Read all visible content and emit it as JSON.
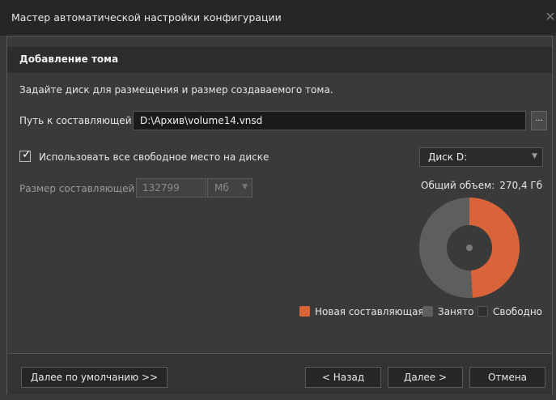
{
  "window": {
    "title": "Мастер автоматической настройки конфигурации",
    "close_glyph": "✕"
  },
  "section": {
    "header": "Добавление тома",
    "description": "Задайте диск для размещения и размер создаваемого тома."
  },
  "path": {
    "label": "Путь к составляющей:",
    "value": "D:\\Архив\\volume14.vnsd",
    "browse_label": "..."
  },
  "use_all_space": {
    "label": "Использовать все свободное место на диске",
    "checked": true,
    "check_glyph": "✓"
  },
  "size": {
    "label": "Размер составляющей",
    "value": "132799",
    "unit": "Мб",
    "disabled": true
  },
  "disk": {
    "selected": "Диск D:",
    "total_label": "Общий объем:",
    "total_value": "270,4 Гб"
  },
  "usage_chart": {
    "new_fraction": 0.49,
    "used_fraction": 0.51,
    "free_fraction": 0.0,
    "colors": {
      "new": "#d9643a",
      "used": "#5e5e5e",
      "free": "#2e2e2e"
    }
  },
  "legend": {
    "new": "Новая составляющая",
    "used": "Занято",
    "free": "Свободно"
  },
  "buttons": {
    "defaults": "Далее по умолчанию >>",
    "back": "< Назад",
    "next": "Далее >",
    "cancel": "Отмена"
  },
  "icons": {
    "dropdown": "chevron-down-icon",
    "check": "check-icon",
    "close": "close-icon"
  }
}
